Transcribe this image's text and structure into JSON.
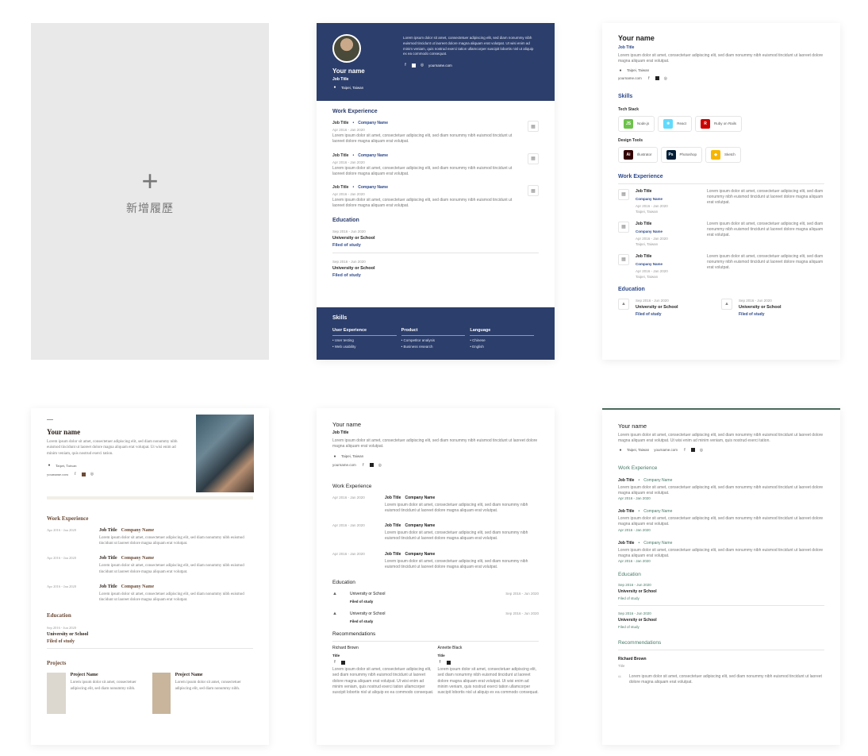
{
  "add_card": {
    "plus": "+",
    "label": "新增履歷"
  },
  "common": {
    "name": "Your name",
    "job_title": "Job Title",
    "location": "Taipei, Taiwan",
    "website": "yourname.com",
    "lorem_long": "Lorem ipsum dolor sit amet, consectetuer adipiscing elit, sed diam nonummy nibh euismod tincidunt ut laoreet dolore magna aliquam erat volutpat. Ut wisi enim ad minim veniam, quis nostrud exerci tation ullamcorper suscipit lobortis nisl ut aliquip ex ea commodo consequat.",
    "lorem_short": "Lorem ipsum dolor sit amet, consectetuer adipiscing elit, sed diam nonummy nibh euismod tincidunt ut laoreet dolore magna aliquam erat volutpat.",
    "lorem_mid": "Lorem ipsum dolor sit amet, consectetuer adipiscing elit, sed diam nonummy nibh euismod tincidunt ut laoreet dolore magna aliquam erat volutpat. Ut wisi enim ad minim veniam, quis nostrud exerci tation.",
    "job_title_label": "Job Title",
    "company_name": "Company Name",
    "date_range": "Apr 2016 - Jan 2020",
    "edu_dates": "Sep 2016 - Jun 2020",
    "school": "University or School",
    "field": "Filed of study",
    "work_experience": "Work Experience",
    "education": "Education",
    "skills": "Skills",
    "projects": "Projects",
    "recommendations": "Recommendations",
    "project_name": "Project Name",
    "lorem_project": "Lorem ipsum dolor sit amet, consectetuer adipiscing elit, sed diam nonummy nibh."
  },
  "card2": {
    "skills_cols": [
      {
        "title": "User Experience",
        "items": [
          "• User testing",
          "• Web usability"
        ]
      },
      {
        "title": "Product",
        "items": [
          "• Competitor analysis",
          "• Business research"
        ]
      },
      {
        "title": "Language",
        "items": [
          "• Chinese",
          "• English"
        ]
      }
    ]
  },
  "card3": {
    "tech_stack_title": "Tech Stack",
    "tech_stack": [
      "Node.js",
      "React",
      "Ruby on Rails"
    ],
    "design_tools_title": "Design Tools",
    "design_tools": [
      "Illustrator",
      "Photoshop",
      "Sketch"
    ]
  },
  "card5": {
    "recommenders": [
      {
        "name": "Richard Brown",
        "title": "Title"
      },
      {
        "name": "Annette Black",
        "title": "Title"
      }
    ]
  },
  "card6": {
    "recommender": {
      "name": "Richard Brown",
      "title": "Title"
    },
    "quote_mark": "“"
  },
  "colors": {
    "navy": "#2c3e6b",
    "blue_accent": "#2f4a8a",
    "brown_accent": "#6b4a36",
    "green_accent": "#4a7a6a"
  }
}
